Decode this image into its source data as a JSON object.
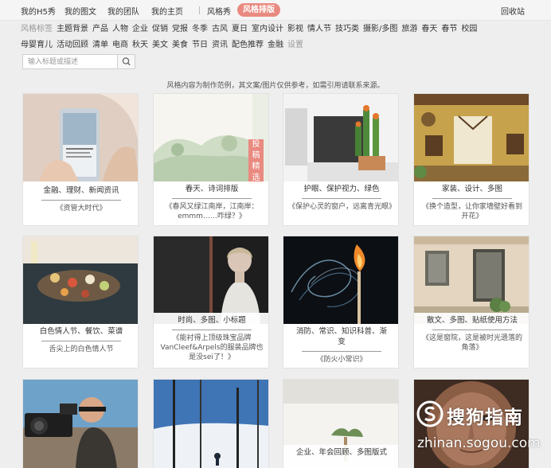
{
  "topnav": {
    "items": [
      "我的H5秀",
      "我的图文",
      "我的团队",
      "我的主页",
      "风格秀"
    ],
    "active": "风格排版",
    "recycle": "回收站"
  },
  "tags": {
    "row1": [
      "风格标签",
      "主题背景",
      "产品",
      "人物",
      "企业",
      "促销",
      "党报",
      "冬季",
      "古风",
      "夏日",
      "室内设计",
      "影视",
      "情人节",
      "技巧类",
      "摄影/多图",
      "旅游",
      "春天",
      "春节",
      "校园"
    ],
    "row2": [
      "母婴育儿",
      "活动回顾",
      "清单",
      "电商",
      "秋天",
      "美文",
      "美食",
      "节日",
      "资讯",
      "配色推荐",
      "金融",
      "设置"
    ]
  },
  "search": {
    "placeholder": "输入标题或描述"
  },
  "notice": "风格内容为制作范例，其文案/图片仅供参考，如需引用请联系来源。",
  "ribbon": "投稿精选",
  "cards": [
    {
      "tags": "金融、理财、新闻资讯",
      "title": "《资管大时代》"
    },
    {
      "tags": "春天、诗词排版",
      "title": "《春风又绿江南岸，江南岸：emmm……咋绿？》"
    },
    {
      "tags": "护眼、保护视力、绿色",
      "title": "《保护心灵的窗户，远离青光眼》"
    },
    {
      "tags": "家装、设计、多图",
      "title": "《换个造型，让你家墙壁好看到开花》"
    },
    {
      "tags": "白色情人节、餐饮、菜谱",
      "title": "舌尖上的白色情人节"
    },
    {
      "tags": "时尚、多图、小标题",
      "title": "《能衬得上顶级珠宝品牌VanCleef&Arpels的服装品牌也是没sei了！》"
    },
    {
      "tags": "消防、常识、知识科普、渐变",
      "title": "《防火小常识》"
    },
    {
      "tags": "散文、多图、贴纸使用方法",
      "title": "《这是窗院，这是被时光遗落的角落》"
    },
    {
      "tags": "",
      "title": ""
    },
    {
      "tags": "",
      "title": ""
    },
    {
      "tags": "企业、年会回顾、多图版式",
      "title": ""
    },
    {
      "tags": "",
      "title": ""
    }
  ],
  "watermark": {
    "brand": "搜狗指南",
    "url": "zhinan.sogou.com"
  },
  "colors": {
    "accent": "#e98a80",
    "background": "#eeeeee"
  }
}
